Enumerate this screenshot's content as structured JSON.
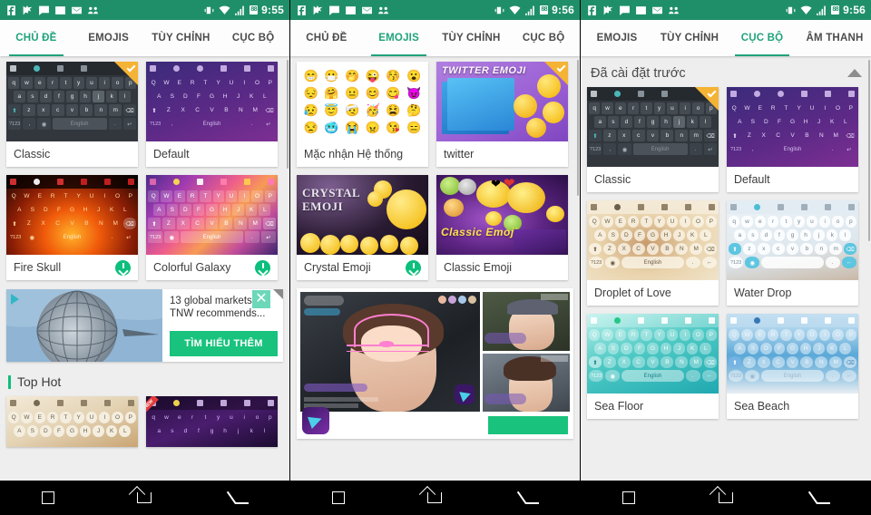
{
  "screens": [
    {
      "name": "themes-screen",
      "statusbar": {
        "time": "9:55",
        "battery": "88",
        "icons": [
          "facebook-icon",
          "messenger-flag-icon",
          "chat-bubble-icon",
          "photo-icon",
          "gmail-icon",
          "contacts-icon"
        ],
        "right_icons": [
          "vibrate-icon",
          "wifi-icon",
          "signal-icon",
          "battery-icon"
        ]
      },
      "tabs": [
        {
          "label": "CHỦ ĐỀ",
          "active": true
        },
        {
          "label": "EMOJIS",
          "active": false
        },
        {
          "label": "TÙY CHỈNH",
          "active": false
        },
        {
          "label": "CỤC BỘ",
          "active": false
        }
      ],
      "cards": [
        {
          "title": "Classic",
          "selected": true,
          "download": false
        },
        {
          "title": "Default",
          "selected": false,
          "download": false
        },
        {
          "title": "Fire Skull",
          "selected": false,
          "download": true
        },
        {
          "title": "Colorful Galaxy",
          "selected": false,
          "download": true
        }
      ],
      "ad": {
        "line1": "13 global markets",
        "line2": "TNW recommends...",
        "button": "TÌM HIỂU THÊM",
        "close": "✕"
      },
      "section": {
        "title": "Top Hot"
      },
      "hot_cards": [
        {
          "title": "",
          "badge": ""
        },
        {
          "title": "",
          "badge": "NEW"
        }
      ]
    },
    {
      "name": "emojis-screen",
      "statusbar": {
        "time": "9:56",
        "battery": "88",
        "icons": [
          "facebook-icon",
          "messenger-flag-icon",
          "chat-bubble-icon",
          "photo-icon",
          "gmail-icon",
          "contacts-icon"
        ],
        "right_icons": [
          "vibrate-icon",
          "wifi-icon",
          "signal-icon",
          "battery-icon"
        ]
      },
      "tabs": [
        {
          "label": "CHỦ ĐỀ",
          "active": false
        },
        {
          "label": "EMOJIS",
          "active": true
        },
        {
          "label": "TÙY CHỈNH",
          "active": false
        },
        {
          "label": "CỤC BỘ",
          "active": false
        }
      ],
      "cards": [
        {
          "title": "Mặc nhận Hệ thống",
          "selected": false,
          "download": false
        },
        {
          "title": "twitter",
          "selected": true,
          "download": false
        },
        {
          "title": "Crystal Emoji",
          "selected": false,
          "download": true
        },
        {
          "title": "Classic Emoji",
          "selected": false,
          "download": false
        }
      ],
      "emoji_preview": [
        "😁",
        "😷",
        "🤭",
        "😜",
        "😚",
        "😮",
        "😔",
        "🤗",
        "😐",
        "😊",
        "😋",
        "😈",
        "😥",
        "😇",
        "🤕",
        "🥳",
        "😫",
        "🤔",
        "😒",
        "🥶",
        "😭",
        "😠",
        "😘",
        "😑"
      ],
      "art": [
        {
          "title": "TWITTER EMOJI"
        },
        {
          "title": "CRYSTAL EMOJI"
        },
        {
          "title": "Classic Emoji"
        }
      ]
    },
    {
      "name": "local-screen",
      "statusbar": {
        "time": "9:56",
        "battery": "88",
        "icons": [
          "facebook-icon",
          "messenger-flag-icon",
          "chat-bubble-icon",
          "photo-icon",
          "gmail-icon",
          "contacts-icon"
        ],
        "right_icons": [
          "vibrate-icon",
          "wifi-icon",
          "signal-icon",
          "battery-icon"
        ]
      },
      "tabs": [
        {
          "label": "EMOJIS",
          "active": false
        },
        {
          "label": "TÙY CHỈNH",
          "active": false
        },
        {
          "label": "CỤC BỘ",
          "active": true
        },
        {
          "label": "ÂM THANH",
          "active": false
        }
      ],
      "section": {
        "title": "Đã cài đặt trước",
        "collapse_icon": "chevron-up-icon"
      },
      "cards": [
        {
          "title": "Classic",
          "selected": true,
          "download": false
        },
        {
          "title": "Default",
          "selected": false,
          "download": false
        },
        {
          "title": "Droplet of Love",
          "selected": false,
          "download": false
        },
        {
          "title": "Water Drop",
          "selected": false,
          "download": false
        },
        {
          "title": "Sea Floor",
          "selected": false,
          "download": false
        },
        {
          "title": "Sea Beach",
          "selected": false,
          "download": false
        }
      ]
    }
  ],
  "navbar": {
    "recents_label": "recents",
    "home_label": "home",
    "back_label": "back"
  },
  "colors": {
    "status_bar": "#1f8f6a",
    "accent": "#1fa37a",
    "download_green": "#0cbf7c",
    "selected_corner": "#f5b335",
    "ad_button": "#19c37d",
    "page_bg": "#eeeeee"
  },
  "keyboard_labels": {
    "row1": [
      "q",
      "w",
      "e",
      "r",
      "t",
      "y",
      "u",
      "i",
      "o",
      "p"
    ],
    "row1u": [
      "Q",
      "W",
      "E",
      "R",
      "T",
      "Y",
      "U",
      "I",
      "O",
      "P"
    ],
    "row2": [
      "a",
      "s",
      "d",
      "f",
      "g",
      "h",
      "j",
      "k",
      "l"
    ],
    "row2u": [
      "A",
      "S",
      "D",
      "F",
      "G",
      "H",
      "J",
      "K",
      "L"
    ],
    "row3": [
      "z",
      "x",
      "c",
      "v",
      "b",
      "n",
      "m"
    ],
    "row3u": [
      "Z",
      "X",
      "C",
      "V",
      "B",
      "N",
      "M"
    ],
    "numkey": "?123",
    "space": "English",
    "comma": ",",
    "period": "."
  }
}
